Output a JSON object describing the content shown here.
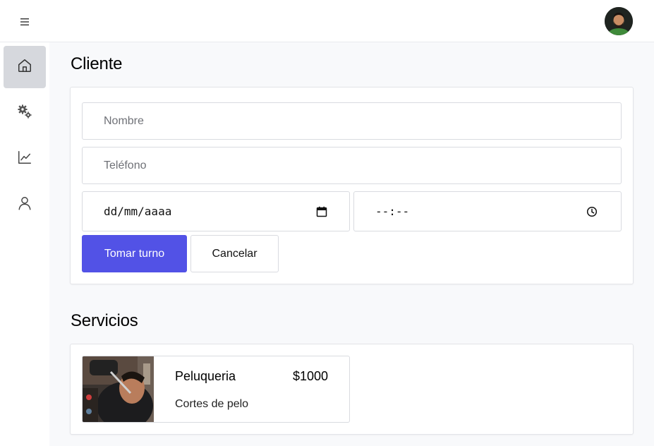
{
  "header": {
    "menu_icon": "hamburger-icon",
    "avatar_icon": "user-avatar"
  },
  "sidebar": {
    "items": [
      {
        "icon": "home-icon",
        "active": true
      },
      {
        "icon": "gears-icon",
        "active": false
      },
      {
        "icon": "chart-icon",
        "active": false
      },
      {
        "icon": "user-icon",
        "active": false
      }
    ]
  },
  "cliente": {
    "title": "Cliente",
    "nombre_placeholder": "Nombre",
    "nombre_value": "",
    "telefono_placeholder": "Teléfono",
    "telefono_value": "",
    "date_display": "dd/mm/aaaa",
    "time_display": "--:--",
    "submit_label": "Tomar turno",
    "cancel_label": "Cancelar"
  },
  "servicios": {
    "title": "Servicios",
    "items": [
      {
        "name": "Peluqueria",
        "price": "$1000",
        "description": "Cortes de pelo"
      }
    ]
  },
  "colors": {
    "primary": "#5252e6",
    "active_nav": "#d6d8dd",
    "background": "#f8f9fb"
  }
}
